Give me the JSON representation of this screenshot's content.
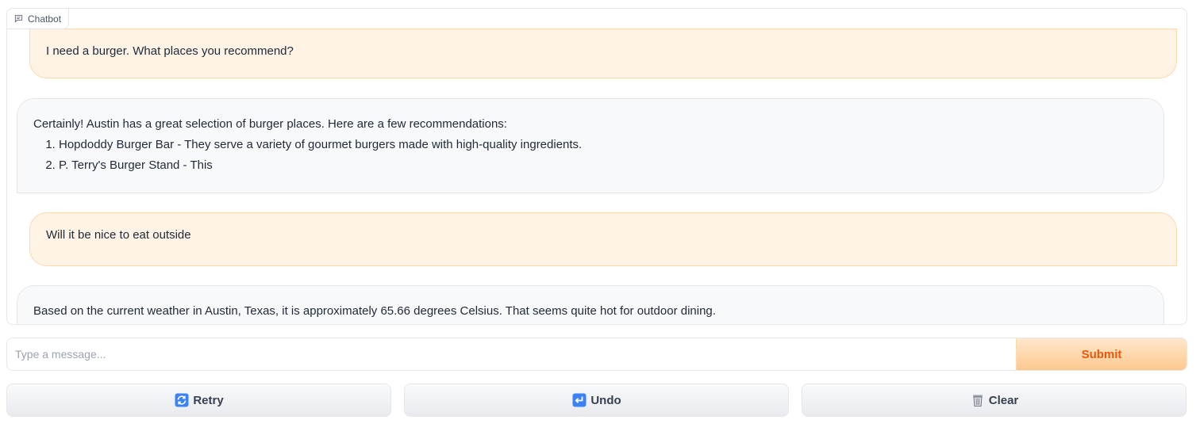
{
  "chatbot": {
    "label": "Chatbot",
    "messages": [
      {
        "role": "user",
        "text": "I need a burger. What places you recommend?"
      },
      {
        "role": "bot",
        "intro": "Certainly! Austin has a great selection of burger places. Here are a few recommendations:",
        "list": [
          "Hopdoddy Burger Bar - They serve a variety of gourmet burgers made with high-quality ingredients.",
          "P. Terry's Burger Stand - This"
        ]
      },
      {
        "role": "user",
        "text": "Will it be nice to eat outside"
      },
      {
        "role": "bot",
        "text": "Based on the current weather in Austin, Texas, it is approximately 65.66 degrees Celsius. That seems quite hot for outdoor dining."
      }
    ]
  },
  "input": {
    "placeholder": "Type a message...",
    "value": "",
    "submit_label": "Submit"
  },
  "actions": {
    "retry_label": "Retry",
    "undo_label": "Undo",
    "clear_label": "Clear"
  },
  "colors": {
    "user_bubble": "#fff3e6",
    "user_border": "#fcd9a9",
    "bot_bubble": "#f8f9fb",
    "accent": "#ea580c"
  }
}
